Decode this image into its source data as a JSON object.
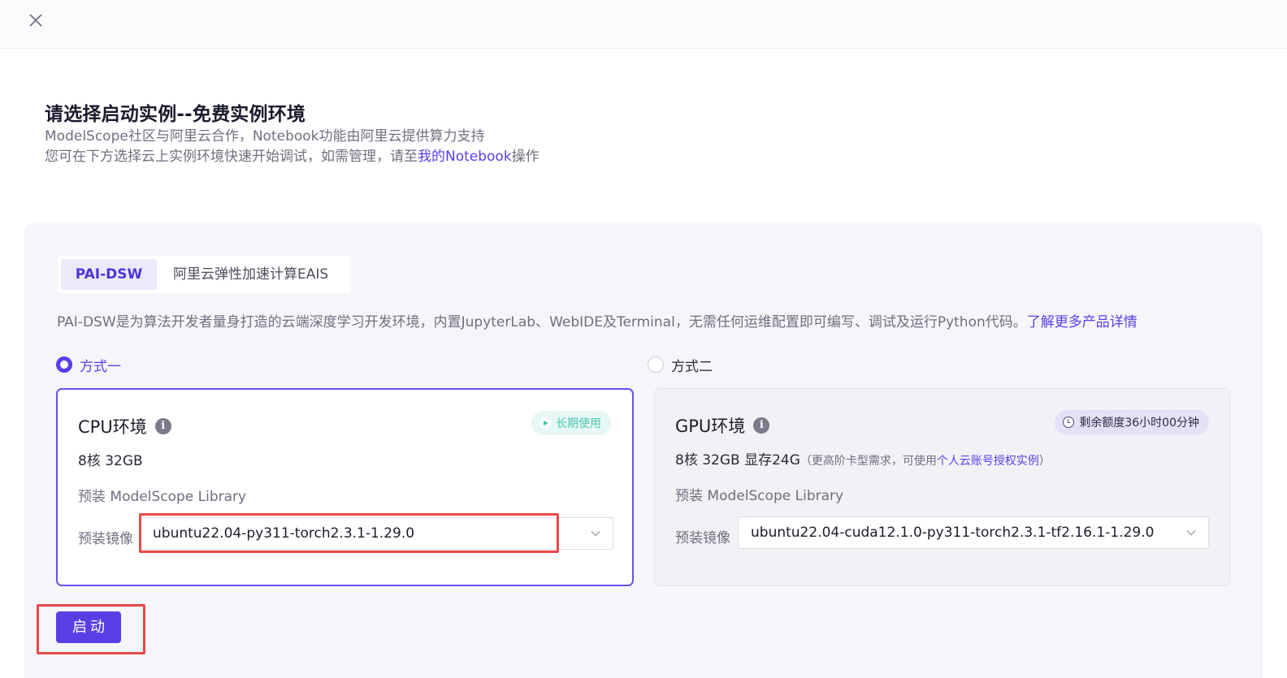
{
  "header": {
    "close_icon": "close-icon"
  },
  "intro": {
    "title": "请选择启动实例--免费实例环境",
    "line1": "ModelScope社区与阿里云合作，Notebook功能由阿里云提供算力支持",
    "line2_prefix": "您可在下方选择云上实例环境快速开始调试，如需管理，请至",
    "line2_link": "我的Notebook",
    "line2_suffix": "操作"
  },
  "tabs": [
    {
      "label": "PAI-DSW",
      "active": true
    },
    {
      "label": "阿里云弹性加速计算EAIS",
      "active": false
    }
  ],
  "description": {
    "text": "PAI-DSW是为算法开发者量身打造的云端深度学习开发环境，内置JupyterLab、WebIDE及Terminal，无需任何运维配置即可编写、调试及运行Python代码。",
    "link": "了解更多产品详情"
  },
  "options": [
    {
      "radio_label": "方式一",
      "selected": true,
      "title": "CPU环境",
      "badge": "长期使用",
      "badge_icon": "play-icon",
      "spec": "8核 32GB",
      "library": "预装 ModelScope Library",
      "image_label": "预装镜像",
      "image_value": "ubuntu22.04-py311-torch2.3.1-1.29.0"
    },
    {
      "radio_label": "方式二",
      "selected": false,
      "title": "GPU环境",
      "badge": "剩余额度36小时00分钟",
      "badge_icon": "clock-icon",
      "spec": "8核 32GB 显存24G",
      "spec_note_prefix": "（更高阶卡型需求，可使用",
      "spec_note_link": "个人云账号授权实例",
      "spec_note_suffix": "）",
      "library": "预装 ModelScope Library",
      "image_label": "预装镜像",
      "image_value": "ubuntu22.04-cuda12.1.0-py311-torch2.3.1-tf2.16.1-1.29.0"
    }
  ],
  "actions": {
    "start_label": "启动"
  },
  "colors": {
    "accent": "#5b3fe6",
    "highlight": "#e84848",
    "panel_bg": "#f5f6fa"
  }
}
